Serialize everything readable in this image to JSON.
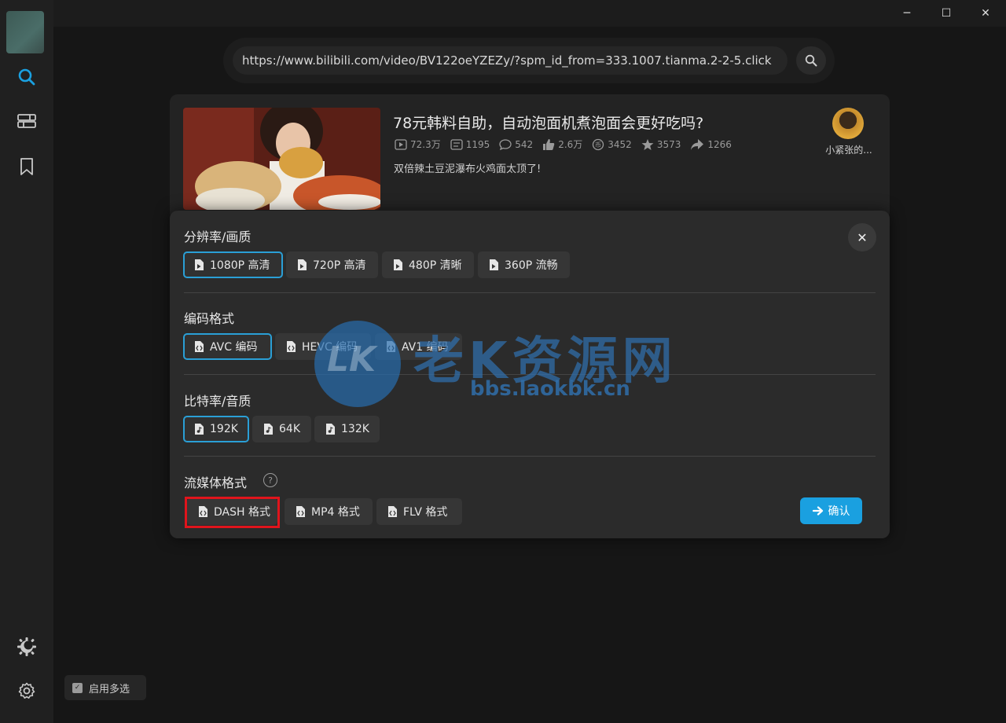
{
  "window": {
    "minimize_label": "─",
    "maximize_label": "☐",
    "close_label": "✕"
  },
  "sidebar": {
    "items": [
      {
        "name": "search",
        "icon": "search-icon",
        "active": true
      },
      {
        "name": "list",
        "icon": "list-icon",
        "active": false
      },
      {
        "name": "bookmark",
        "icon": "bookmark-icon",
        "active": false
      }
    ],
    "bottom": [
      {
        "name": "theme",
        "icon": "theme-toggle-icon"
      },
      {
        "name": "settings",
        "icon": "gear-icon"
      }
    ]
  },
  "search": {
    "url": "https://www.bilibili.com/video/BV122oeYZEZy/?spm_id_from=333.1007.tianma.2-2-5.click"
  },
  "video": {
    "title": "78元韩料自助，自动泡面机煮泡面会更好吃吗?",
    "stats": {
      "views": "72.3万",
      "danmaku": "1195",
      "comments": "542",
      "likes": "2.6万",
      "coins": "3452",
      "favorites": "3573",
      "shares": "1266"
    },
    "description": "双倍辣土豆泥瀑布火鸡面太顶了!",
    "uploader": "小紧张的..."
  },
  "dialog": {
    "sections": [
      {
        "title": "分辨率/画质",
        "options": [
          "1080P 高清",
          "720P 高清",
          "480P 清晰",
          "360P 流畅"
        ],
        "selected": 0
      },
      {
        "title": "编码格式",
        "options": [
          "AVC 编码",
          "HEVC 编码",
          "AV1 编码"
        ],
        "selected": 0
      },
      {
        "title": "比特率/音质",
        "options": [
          "192K",
          "64K",
          "132K"
        ],
        "selected": 0
      },
      {
        "title": "流媒体格式",
        "options": [
          "DASH 格式",
          "MP4 格式",
          "FLV 格式"
        ],
        "selected": 0
      }
    ],
    "help_label": "?",
    "close_label": "✕",
    "confirm_label": "确认"
  },
  "watermark": {
    "logo_text": "LK",
    "text": "老K资源网",
    "url": "bbs.laokbk.cn"
  },
  "footer": {
    "multi_select_label": "启用多选",
    "multi_select_checked": true
  },
  "colors": {
    "accent": "#1aa0e0",
    "highlight": "#e0141c"
  }
}
